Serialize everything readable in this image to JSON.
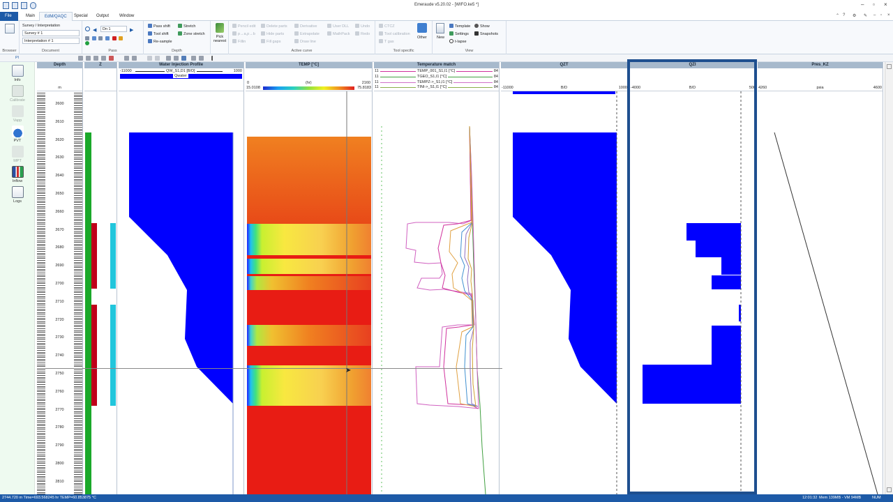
{
  "window": {
    "title": "Emeraude  v5.20.02 - [WIFO.ke5 *]",
    "minimize": "–",
    "maximize": "▫",
    "close": "×"
  },
  "menu": {
    "items": [
      "File",
      "Main",
      "EdM/QAQC",
      "Special",
      "Output",
      "Window"
    ],
    "active": "EdM/QAQC"
  },
  "ribbon": {
    "browser_label": "Browser",
    "document_label": "Document",
    "survey_label": "Survey / Interpretation",
    "survey_value": "Survey # 1",
    "interp_value": "Interpretation # 1",
    "pass_value": "Dn 1",
    "pass_label": "Pass",
    "depth_label": "Depth",
    "depth_buttons": [
      "Pass shift",
      "Tool shift",
      "Re-sample",
      "Stretch",
      "Zone stretch"
    ],
    "pick_nearest": "Pick nearest",
    "active_curve_label": "Active curve",
    "active_curve_buttons": [
      "Pencil edit",
      "p→a,p→b",
      "Fillin",
      "Delete parts",
      "Hide parts",
      "Fill gaps",
      "Derivative",
      "Extrapolate",
      "Draw line",
      "User DLL",
      "MathPack",
      "Undo",
      "Redo"
    ],
    "tool_specific_label": "Tool specific",
    "tool_buttons": [
      "CTCZ",
      "Tool calibration",
      "T gas",
      "Other"
    ],
    "view_label": "View",
    "view_buttons": [
      "New",
      "Template",
      "Settings",
      "t-lapse",
      "Show",
      "Snapshots"
    ]
  },
  "browser": {
    "items": [
      {
        "label": "Info",
        "enabled": true
      },
      {
        "label": "Calibrate",
        "enabled": false
      },
      {
        "label": "Vapp",
        "enabled": false
      },
      {
        "label": "PVT",
        "enabled": true
      },
      {
        "label": "MPT",
        "enabled": false
      },
      {
        "label": "Inflow",
        "enabled": true
      },
      {
        "label": "Logs",
        "enabled": true
      }
    ]
  },
  "tracks": {
    "depth": {
      "title": "Depth",
      "unit": "m",
      "ticks": [
        "2600",
        "2610",
        "2620",
        "2630",
        "2640",
        "2650",
        "2660",
        "2670",
        "2680",
        "2690",
        "2700",
        "2710",
        "2720",
        "2730",
        "2740",
        "2750",
        "2760",
        "2770",
        "2780",
        "2790",
        "2800",
        "2810"
      ]
    },
    "z": {
      "title": "Z"
    },
    "wip": {
      "title": "Water Injection Profile",
      "scale_min": "-11000",
      "scale_max": "1000",
      "curve": "QW_S1,D1 [B/D]",
      "legend": "Qwater"
    },
    "temp": {
      "title": "TEMP [°C]",
      "scale_min": "0",
      "scale_unit": "(hr)",
      "scale_max": "2160",
      "color_min": "15.0108",
      "color_max": "75.8183"
    },
    "tmatch": {
      "title": "Temperature match",
      "rows": [
        {
          "left": "11",
          "name": "TEMP_001_S1,I1 [°C]",
          "right": "84",
          "color": "#d0309c"
        },
        {
          "left": "11",
          "name": "TGEO_S1,I1 [°C]",
          "right": "84",
          "color": "#40a040"
        },
        {
          "left": "11",
          "name": "TEMPZ->_S1,I1 [°C]",
          "right": "84",
          "color": "#d070c8"
        },
        {
          "left": "11",
          "name": "TINI->_S1,I1 [°C]",
          "right": "84",
          "color": "#8ab04a"
        }
      ]
    },
    "qzt": {
      "title": "QZT",
      "scale_min": "-11000",
      "unit": "B/D",
      "scale_max": "1000"
    },
    "qzi": {
      "title": "QZI",
      "scale_min": "-4000",
      "unit": "B/D",
      "scale_max": "500"
    },
    "pres": {
      "title": "Pres_KZ",
      "scale_min": "4260",
      "unit": "psia",
      "scale_max": "4600"
    }
  },
  "status": {
    "left": "2744.720 m  Time=693.568245 hr  TEMP=60.853875 °C",
    "time": "12:01:32",
    "mem": "Mem 139MB - VM 94MB",
    "num": "NUM"
  },
  "colors": {
    "accent": "#1d5aa7",
    "track_header": "#a7b9cc",
    "flow_blue": "#0000ff",
    "zone_green": "#1aa82a",
    "zone_red": "#c0001a",
    "zone_cyan": "#22c6dc",
    "browser_bg": "#eefaf0"
  },
  "icons": [
    "info-icon",
    "calibrate-icon",
    "vapp-icon",
    "pvt-icon",
    "mpt-icon",
    "inflow-icon",
    "logs-icon",
    "pick-nearest-icon",
    "new-view-icon",
    "other-icon"
  ]
}
